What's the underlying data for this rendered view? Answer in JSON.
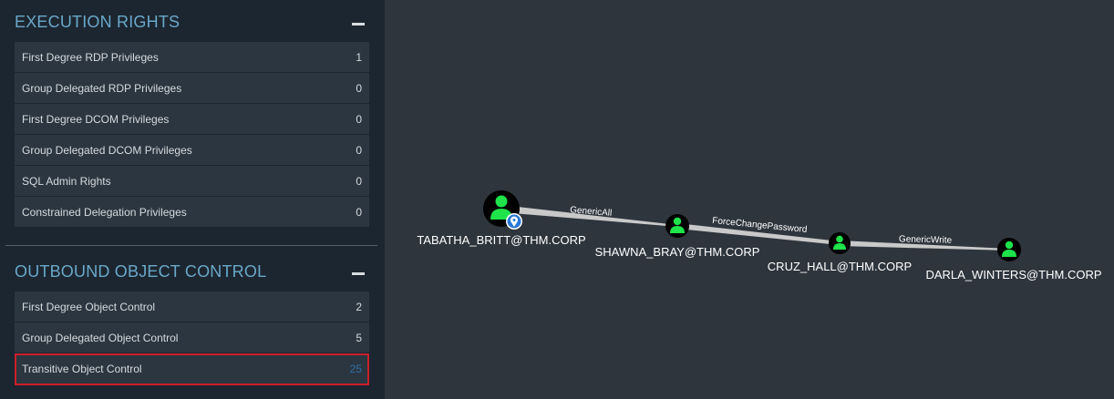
{
  "sections": [
    {
      "title": "EXECUTION RIGHTS",
      "rows": [
        {
          "label": "First Degree RDP Privileges",
          "count": "1"
        },
        {
          "label": "Group Delegated RDP Privileges",
          "count": "0"
        },
        {
          "label": "First Degree DCOM Privileges",
          "count": "0"
        },
        {
          "label": "Group Delegated DCOM Privileges",
          "count": "0"
        },
        {
          "label": "SQL Admin Rights",
          "count": "0"
        },
        {
          "label": "Constrained Delegation Privileges",
          "count": "0"
        }
      ]
    },
    {
      "title": "OUTBOUND OBJECT CONTROL",
      "rows": [
        {
          "label": "First Degree Object Control",
          "count": "2"
        },
        {
          "label": "Group Delegated Object Control",
          "count": "5"
        },
        {
          "label": "Transitive Object Control",
          "count": "25",
          "selected": true
        }
      ]
    }
  ],
  "graph": {
    "nodes": [
      {
        "name": "TABATHA_BRITT@THM.CORP",
        "icon": "user-icon",
        "badge": "location-pin-icon"
      },
      {
        "name": "SHAWNA_BRAY@THM.CORP",
        "icon": "user-icon"
      },
      {
        "name": "CRUZ_HALL@THM.CORP",
        "icon": "user-icon"
      },
      {
        "name": "DARLA_WINTERS@THM.CORP",
        "icon": "user-icon"
      }
    ],
    "edges": [
      {
        "label": "GenericAll"
      },
      {
        "label": "ForceChangePassword"
      },
      {
        "label": "GenericWrite"
      }
    ]
  },
  "colors": {
    "sidebar_bg": "#1c2630",
    "section_title": "#6aa8c9",
    "row_bg": "#2b3640",
    "canvas_bg": "#2f353d",
    "node_user": "#1ee34b",
    "edge": "#c9c9c9",
    "selected_outline": "#cc1f2a"
  }
}
